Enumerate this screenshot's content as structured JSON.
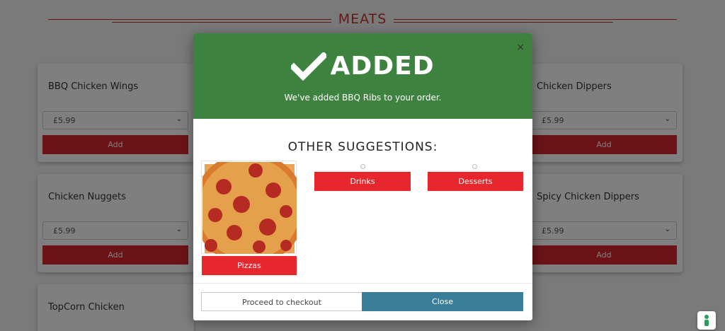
{
  "section": {
    "title": "MEATS"
  },
  "products": [
    {
      "name": "BBQ Chicken Wings",
      "price": "£5.99",
      "add_label": "Add"
    },
    {
      "name": "Chicken Dippers",
      "price": "£5.99",
      "add_label": "Add"
    },
    {
      "name": "Chicken Nuggets",
      "price": "£5.99",
      "add_label": "Add"
    },
    {
      "name": "Spicy Chicken Dippers",
      "price": "£5.99",
      "add_label": "Add"
    },
    {
      "name": "TopCorn Chicken"
    }
  ],
  "modal": {
    "close_icon": "×",
    "title": "ADDED",
    "message": "We've added BBQ Ribs to your order.",
    "suggestions_title": "OTHER SUGGESTIONS:",
    "suggestions": [
      {
        "label": "Pizzas",
        "image": "pepperoni-pizza"
      },
      {
        "label": "Drinks"
      },
      {
        "label": "Desserts"
      }
    ],
    "checkout_label": "Proceed to checkout",
    "close_label": "Close"
  },
  "colors": {
    "header_green": "#3e8240",
    "brand_red": "#e8262d",
    "close_blue": "#3a7d99"
  }
}
